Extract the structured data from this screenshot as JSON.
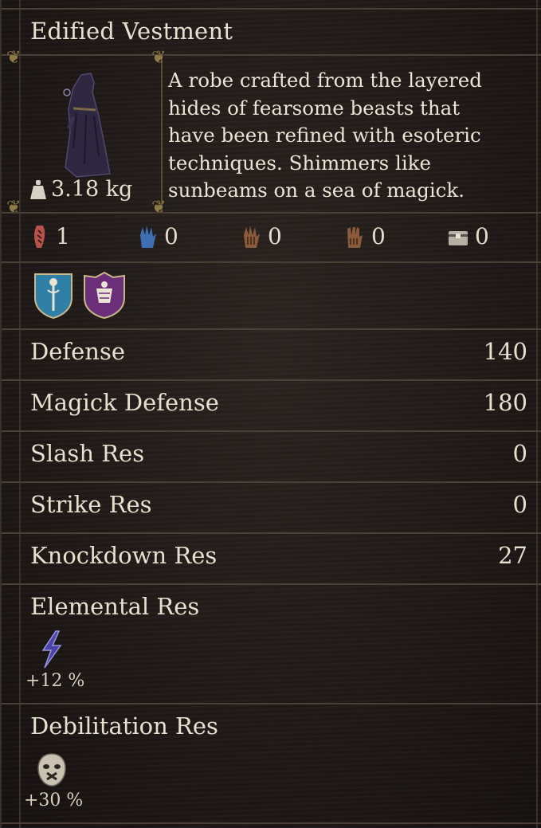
{
  "item": {
    "name": "Edified Vestment",
    "weight": "3.18 kg",
    "description_lines": [
      "A robe crafted from the layered",
      "hides of fearsome beasts that",
      "have been refined with esoteric",
      "techniques. Shimmers like",
      "sunbeams on a sea of magick."
    ]
  },
  "requirements": [
    {
      "icon": "red-claw-icon",
      "value": "1",
      "color": "#b8524a"
    },
    {
      "icon": "blue-hand-icon",
      "value": "0",
      "color": "#3e6fb5"
    },
    {
      "icon": "brown-hand-icon",
      "value": "0",
      "color": "#8a5a3a"
    },
    {
      "icon": "brown-claw-icon",
      "value": "0",
      "color": "#8a5a3a"
    },
    {
      "icon": "chest-icon",
      "value": "0",
      "color": "#b7aea4"
    }
  ],
  "vocation_badges": [
    {
      "icon": "mage-shield-icon",
      "color": "#2f7fa6"
    },
    {
      "icon": "sorcerer-shield-icon",
      "color": "#6b2f7a"
    }
  ],
  "stats": [
    {
      "label": "Defense",
      "value": "140"
    },
    {
      "label": "Magick Defense",
      "value": "180"
    },
    {
      "label": "Slash Res",
      "value": "0"
    },
    {
      "label": "Strike Res",
      "value": "0"
    },
    {
      "label": "Knockdown Res",
      "value": "27"
    }
  ],
  "elemental": {
    "title": "Elemental Res",
    "icon": "lightning-icon",
    "value": "+12 %"
  },
  "debilitation": {
    "title": "Debilitation Res",
    "icon": "silence-mask-icon",
    "value": "+30 %"
  },
  "colors": {
    "background": "#1d1816",
    "divider": "#4a3f36",
    "text": "#e8dfcf",
    "frame_gold": "#8d7a45"
  }
}
